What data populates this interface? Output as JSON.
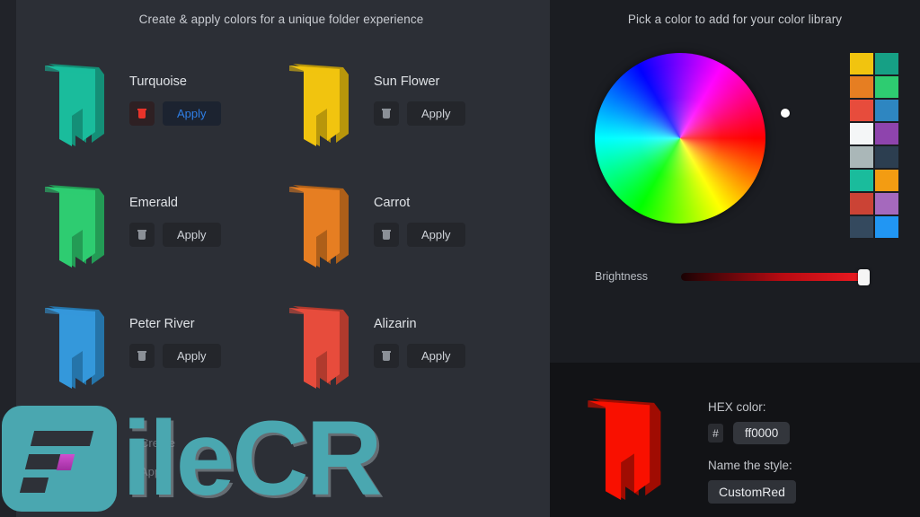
{
  "app": {
    "background": "#17181c",
    "accent_blue": "#2f7fe6",
    "accent_red": "#e8332a"
  },
  "left_panel": {
    "heading": "Create & apply colors for a unique folder experience",
    "delete_icon": "trash-icon",
    "folders": [
      {
        "name": "Turquoise",
        "color": "#1abc9c",
        "shade": "#148f77",
        "apply_label": "Apply",
        "apply_highlight": true,
        "delete_active": true
      },
      {
        "name": "Sun Flower",
        "color": "#f1c40f",
        "shade": "#b8960b",
        "apply_label": "Apply",
        "apply_highlight": false,
        "delete_active": false
      },
      {
        "name": "Emerald",
        "color": "#2ecc71",
        "shade": "#239b55",
        "apply_label": "Apply",
        "apply_highlight": false,
        "delete_active": false
      },
      {
        "name": "Carrot",
        "color": "#e67e22",
        "shade": "#ad5f19",
        "apply_label": "Apply",
        "apply_highlight": false,
        "delete_active": false
      },
      {
        "name": "Peter River",
        "color": "#3498db",
        "shade": "#2574a9",
        "apply_label": "Apply",
        "apply_highlight": false,
        "delete_active": false
      },
      {
        "name": "Alizarin",
        "color": "#e74c3c",
        "shade": "#b03a2d",
        "apply_label": "Apply",
        "apply_highlight": false,
        "delete_active": false
      }
    ]
  },
  "right_panel": {
    "heading": "Pick a color to add for your color library",
    "wheel": {
      "cursor_hue_label": "red-orange",
      "selected_hex": "ff0000"
    },
    "swatches": [
      "#f1c40f",
      "#16a085",
      "#e67e22",
      "#2ecc71",
      "#e74c3c",
      "#2e86c1",
      "#f4f6f7",
      "#8e44ad",
      "#aab7b8",
      "#2c3e50",
      "#1abc9c",
      "#f39c12",
      "#cb4335",
      "#a569bd",
      "#34495e",
      "#2196f3"
    ],
    "brightness": {
      "label": "Brightness",
      "value": 100
    },
    "preview": {
      "color": "#f91000",
      "shade": "#a00c02"
    },
    "hex": {
      "label": "HEX color:",
      "prefix": "#",
      "value": "ff0000"
    },
    "style_name": {
      "label": "Name the style:",
      "value": "CustomRed"
    }
  },
  "watermark": {
    "text": "ileCR",
    "color": "#4aa7b0"
  },
  "background_text": {
    "line1": "Create",
    "line2": "Apply"
  }
}
